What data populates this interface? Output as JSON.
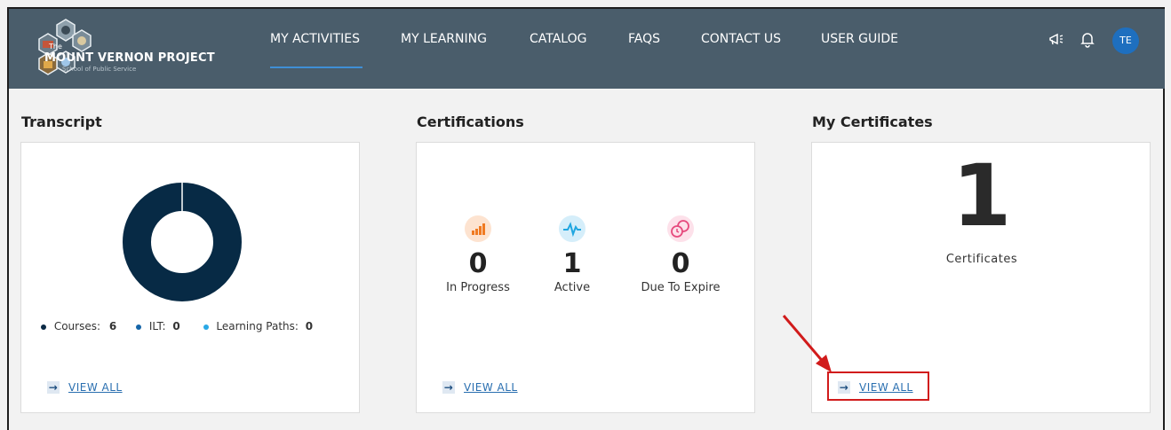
{
  "brand": {
    "the": "The",
    "title": "MOUNT VERNON PROJECT",
    "subtitle": "School of Public Service"
  },
  "nav": {
    "items": [
      {
        "label": "MY ACTIVITIES",
        "active": true
      },
      {
        "label": "MY LEARNING"
      },
      {
        "label": "CATALOG"
      },
      {
        "label": "FAQS"
      },
      {
        "label": "CONTACT US"
      },
      {
        "label": "USER GUIDE"
      }
    ]
  },
  "header_icons": [
    "megaphone-icon",
    "bell-icon"
  ],
  "user": {
    "initials": "TE"
  },
  "transcript": {
    "title": "Transcript",
    "legend": [
      {
        "label": "Courses:",
        "value": "6",
        "color": "#0b2a45"
      },
      {
        "label": "ILT:",
        "value": "0",
        "color": "#1565a8"
      },
      {
        "label": "Learning Paths:",
        "value": "0",
        "color": "#29a8e6"
      }
    ],
    "view_all": "VIEW ALL",
    "donut_color": "#072a45"
  },
  "certifications": {
    "title": "Certifications",
    "stats": [
      {
        "value": "0",
        "label": "In Progress",
        "icon": "bar-chart-icon",
        "color": "#f07a22"
      },
      {
        "value": "1",
        "label": "Active",
        "icon": "pulse-icon",
        "color": "#1fa6e0"
      },
      {
        "value": "0",
        "label": "Due To Expire",
        "icon": "expire-clock-icon",
        "color": "#e64a7d"
      }
    ],
    "view_all": "VIEW ALL"
  },
  "my_certificates": {
    "title": "My Certificates",
    "count": "1",
    "label": "Certificates",
    "view_all": "VIEW ALL"
  },
  "chart_data": {
    "type": "pie",
    "categories": [
      "Courses",
      "ILT",
      "Learning Paths"
    ],
    "values": [
      6,
      0,
      0
    ]
  }
}
